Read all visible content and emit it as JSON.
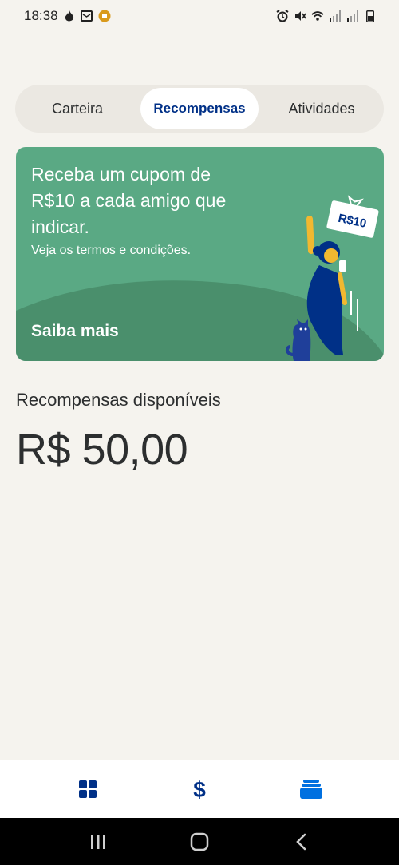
{
  "status_bar": {
    "time": "18:38",
    "left_icons": [
      "flame-icon",
      "mail-icon",
      "coin-icon"
    ],
    "right_icons": [
      "alarm-icon",
      "mute-icon",
      "wifi-icon",
      "signal-icon",
      "signal-icon",
      "battery-icon"
    ]
  },
  "tabs": [
    {
      "label": "Carteira",
      "active": false
    },
    {
      "label": "Recompensas",
      "active": true
    },
    {
      "label": "Atividades",
      "active": false
    }
  ],
  "promo": {
    "headline": "Receba um cupom de R$10 a cada amigo que indicar.",
    "terms": "Veja os termos e condições.",
    "cta": "Saiba mais",
    "coupon_label": "R$10"
  },
  "rewards": {
    "title": "Recompensas disponíveis",
    "amount": "R$ 50,00"
  },
  "bottom_nav": {
    "items": [
      {
        "icon": "dashboard-icon"
      },
      {
        "icon": "dollar-icon"
      },
      {
        "icon": "cards-icon"
      }
    ]
  },
  "system_nav": {
    "items": [
      "recents-icon",
      "home-icon",
      "back-icon"
    ]
  },
  "colors": {
    "background": "#f5f3ee",
    "brand_blue": "#003087",
    "promo_green": "#5aa984",
    "promo_hill": "#4a8f6c",
    "accent_blue": "#0070e0"
  }
}
